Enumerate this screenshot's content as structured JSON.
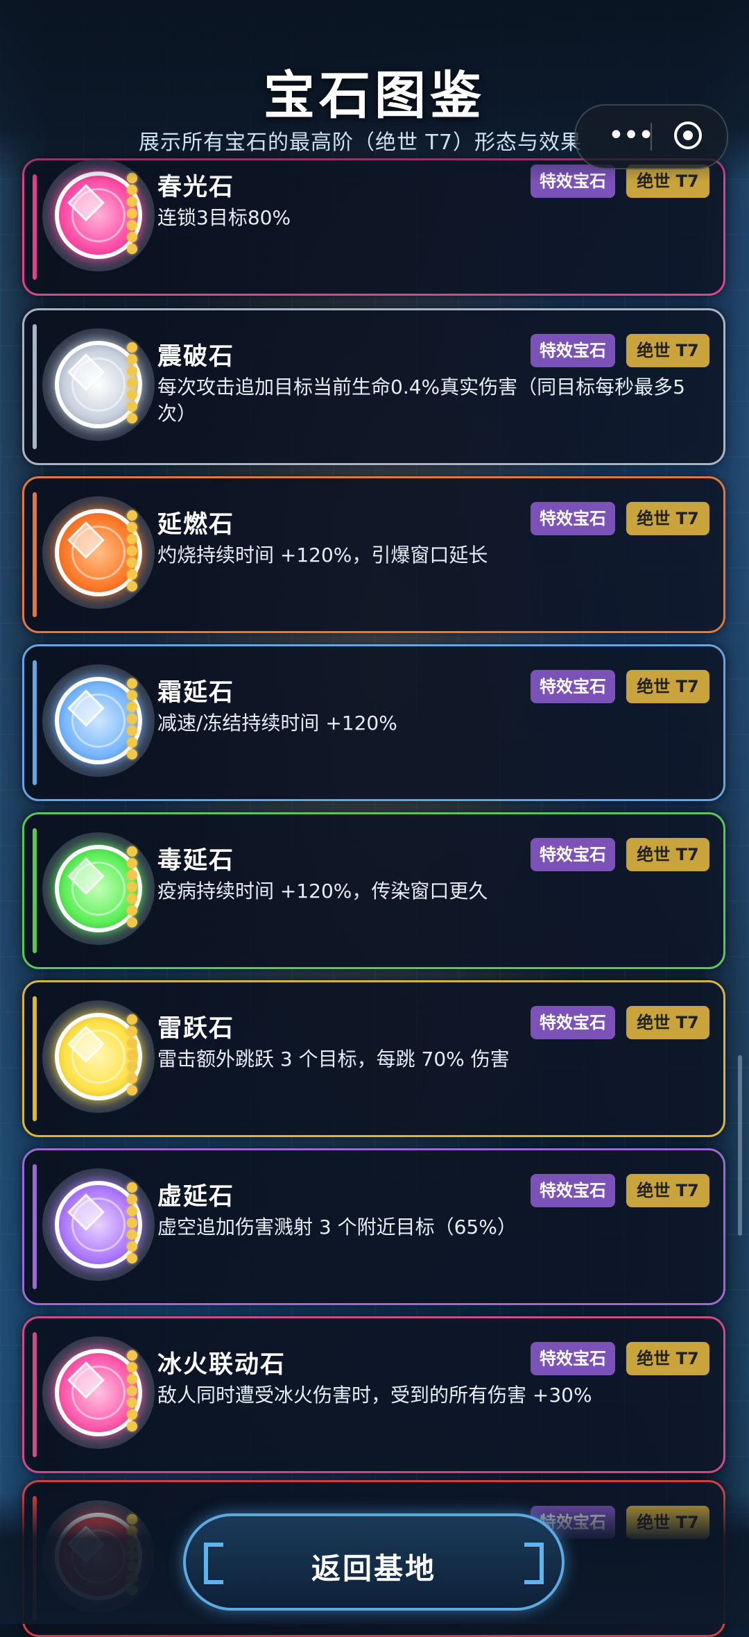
{
  "header": {
    "title": "宝石图鉴",
    "subtitle": "展示所有宝石的最高阶（绝世 T7）形态与效果",
    "more_icon": "•••"
  },
  "gems": [
    {
      "name": "春光石",
      "desc": "连锁3目标80%",
      "type": "特效宝石",
      "tier": "绝世 T7",
      "color": "#e0428a",
      "g1": "#ffb3d9",
      "g2": "#ff4fa8",
      "g3": "#c21f6e"
    },
    {
      "name": "震破石",
      "desc": "每次攻击追加目标当前生命0.4%真实伤害（同目标每秒最多5次）",
      "type": "特效宝石",
      "tier": "绝世 T7",
      "color": "#a8b4c4",
      "g1": "#ffffff",
      "g2": "#c8d2de",
      "g3": "#7c8a9c"
    },
    {
      "name": "延燃石",
      "desc": "灼烧持续时间 +120%，引爆窗口延长",
      "type": "特效宝石",
      "tier": "绝世 T7",
      "color": "#e0783a",
      "g1": "#ffc08a",
      "g2": "#ff7a2a",
      "g3": "#c4501a"
    },
    {
      "name": "霜延石",
      "desc": "减速/冻结持续时间 +120%",
      "type": "特效宝石",
      "tier": "绝世 T7",
      "color": "#6aa4e0",
      "g1": "#cfe6ff",
      "g2": "#7ab8ff",
      "g3": "#3c78c8"
    },
    {
      "name": "毒延石",
      "desc": "疫病持续时间 +120%，传染窗口更久",
      "type": "特效宝石",
      "tier": "绝世 T7",
      "color": "#5ec45a",
      "g1": "#c4ffb8",
      "g2": "#5ef05a",
      "g3": "#2a9e2a"
    },
    {
      "name": "雷跃石",
      "desc": "雷击额外跳跃 3 个目标，每跳 70% 伤害",
      "type": "特效宝石",
      "tier": "绝世 T7",
      "color": "#d4b83c",
      "g1": "#fff6b0",
      "g2": "#ffe24a",
      "g3": "#c8a818"
    },
    {
      "name": "虚延石",
      "desc": "虚空追加伤害溅射 3 个附近目标（65%）",
      "type": "特效宝石",
      "tier": "绝世 T7",
      "color": "#9a6ad0",
      "g1": "#e8d2ff",
      "g2": "#b07cff",
      "g3": "#7240c0"
    },
    {
      "name": "冰火联动石",
      "desc": "敌人同时遭受冰火伤害时，受到的所有伤害 +30%",
      "type": "特效宝石",
      "tier": "绝世 T7",
      "color": "#d04a86",
      "g1": "#ffc4e0",
      "g2": "#ff5cae",
      "g3": "#c02070"
    },
    {
      "name": "",
      "desc": "",
      "type": "特效宝石",
      "tier": "绝世 T7",
      "color": "#d04040",
      "g1": "#ffb0b0",
      "g2": "#ff5050",
      "g3": "#b02020"
    }
  ],
  "footer": {
    "back_label": "返回基地"
  }
}
